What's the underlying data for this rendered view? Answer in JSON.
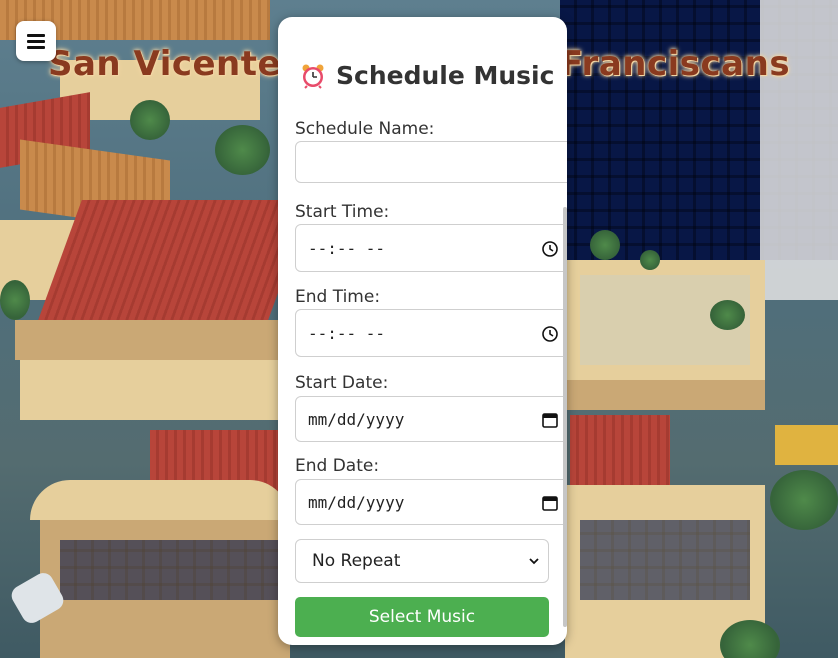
{
  "background": {
    "title_left": "San Vicente",
    "title_right": "Franciscans"
  },
  "menu": {
    "icon": "hamburger-menu-icon"
  },
  "panel": {
    "title": "Schedule Music",
    "title_icon": "alarm-clock-icon",
    "schedule_name_label": "Schedule Name:",
    "schedule_name_value": "",
    "start_time_label": "Start Time:",
    "start_time_placeholder": "--:-- --",
    "end_time_label": "End Time:",
    "end_time_placeholder": "--:-- --",
    "start_date_label": "Start Date:",
    "start_date_placeholder": "mm/dd/yyyy",
    "end_date_label": "End Date:",
    "end_date_placeholder": "mm/dd/yyyy",
    "repeat_selected": "No Repeat",
    "select_music_label": "Select Music"
  },
  "colors": {
    "accent_green": "#4caf50",
    "title_text": "#333333"
  }
}
